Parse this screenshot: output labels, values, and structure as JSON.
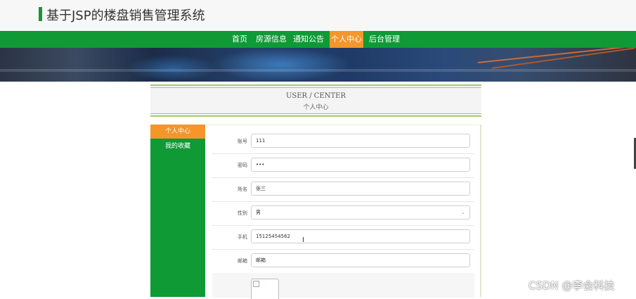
{
  "site": {
    "title": "基于JSP的楼盘销售管理系统"
  },
  "nav": {
    "items": [
      {
        "label": "首页"
      },
      {
        "label": "房源信息"
      },
      {
        "label": "通知公告"
      },
      {
        "label": "个人中心"
      },
      {
        "label": "后台管理"
      }
    ],
    "active": "个人中心"
  },
  "user_center": {
    "title_en": "USER / CENTER",
    "title_cn": "个人中心"
  },
  "sidebar": {
    "items": [
      {
        "label": "个人中心"
      },
      {
        "label": "我的收藏"
      }
    ]
  },
  "form": {
    "fields": [
      {
        "label": "账号",
        "value": "111"
      },
      {
        "label": "密码",
        "value": "•••"
      },
      {
        "label": "姓名",
        "value": "张三"
      },
      {
        "label": "性别",
        "value": "男"
      },
      {
        "label": "手机",
        "value": "15125454562"
      },
      {
        "label": "邮箱",
        "value": "邮箱"
      }
    ]
  },
  "watermark": "CSDN @李会科技",
  "colors": {
    "nav_green": "#0f9a36",
    "active_orange": "#f4962a",
    "accent_green": "#199537"
  }
}
